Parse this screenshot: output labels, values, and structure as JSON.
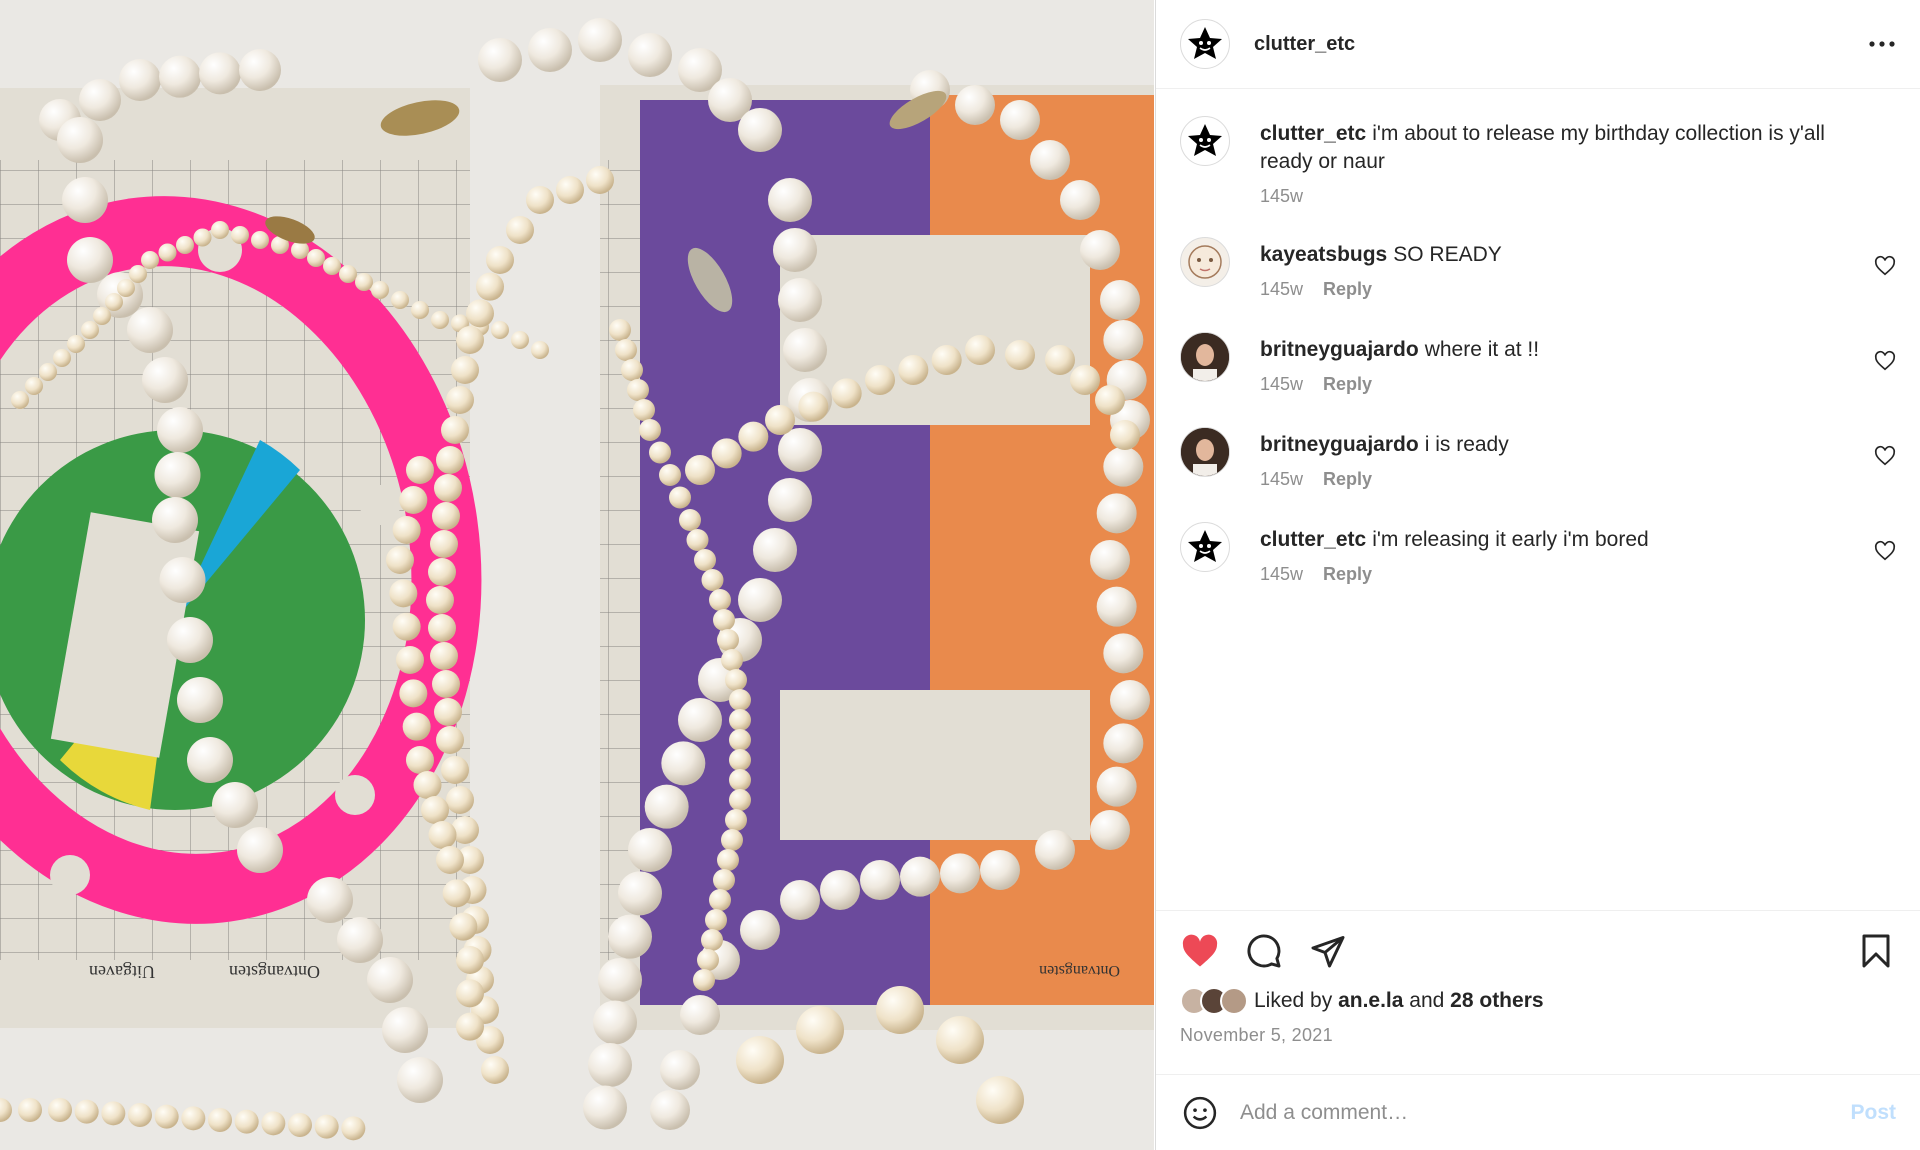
{
  "post": {
    "author": "clutter_etc",
    "more_icon": "more-horizontal-icon",
    "caption": {
      "user": "clutter_etc",
      "text": "i'm about to release my birthday collection is y'all ready or naur",
      "age": "145w"
    },
    "comments": [
      {
        "user": "kayeatsbugs",
        "text": "SO READY",
        "age": "145w",
        "reply_label": "Reply",
        "avatar": "drawn-face"
      },
      {
        "user": "britneyguajardo",
        "text": "where it at !!",
        "age": "145w",
        "reply_label": "Reply",
        "avatar": "photo"
      },
      {
        "user": "britneyguajardo",
        "text": "i is ready",
        "age": "145w",
        "reply_label": "Reply",
        "avatar": "photo"
      },
      {
        "user": "clutter_etc",
        "text": "i'm releasing it early i'm bored",
        "age": "145w",
        "reply_label": "Reply",
        "avatar": "star"
      }
    ],
    "likes": {
      "prefix": "Liked by",
      "first_user": "an.e.la",
      "connector": "and",
      "others": "28 others"
    },
    "date": "November 5, 2021",
    "liked": true,
    "like_color": "#ed4956"
  },
  "composer": {
    "placeholder": "Add a comment…",
    "post_label": "Post"
  },
  "colors": {
    "border": "#dbdbdb",
    "muted": "#8e8e8e",
    "post_disabled": "#c0dffd"
  }
}
